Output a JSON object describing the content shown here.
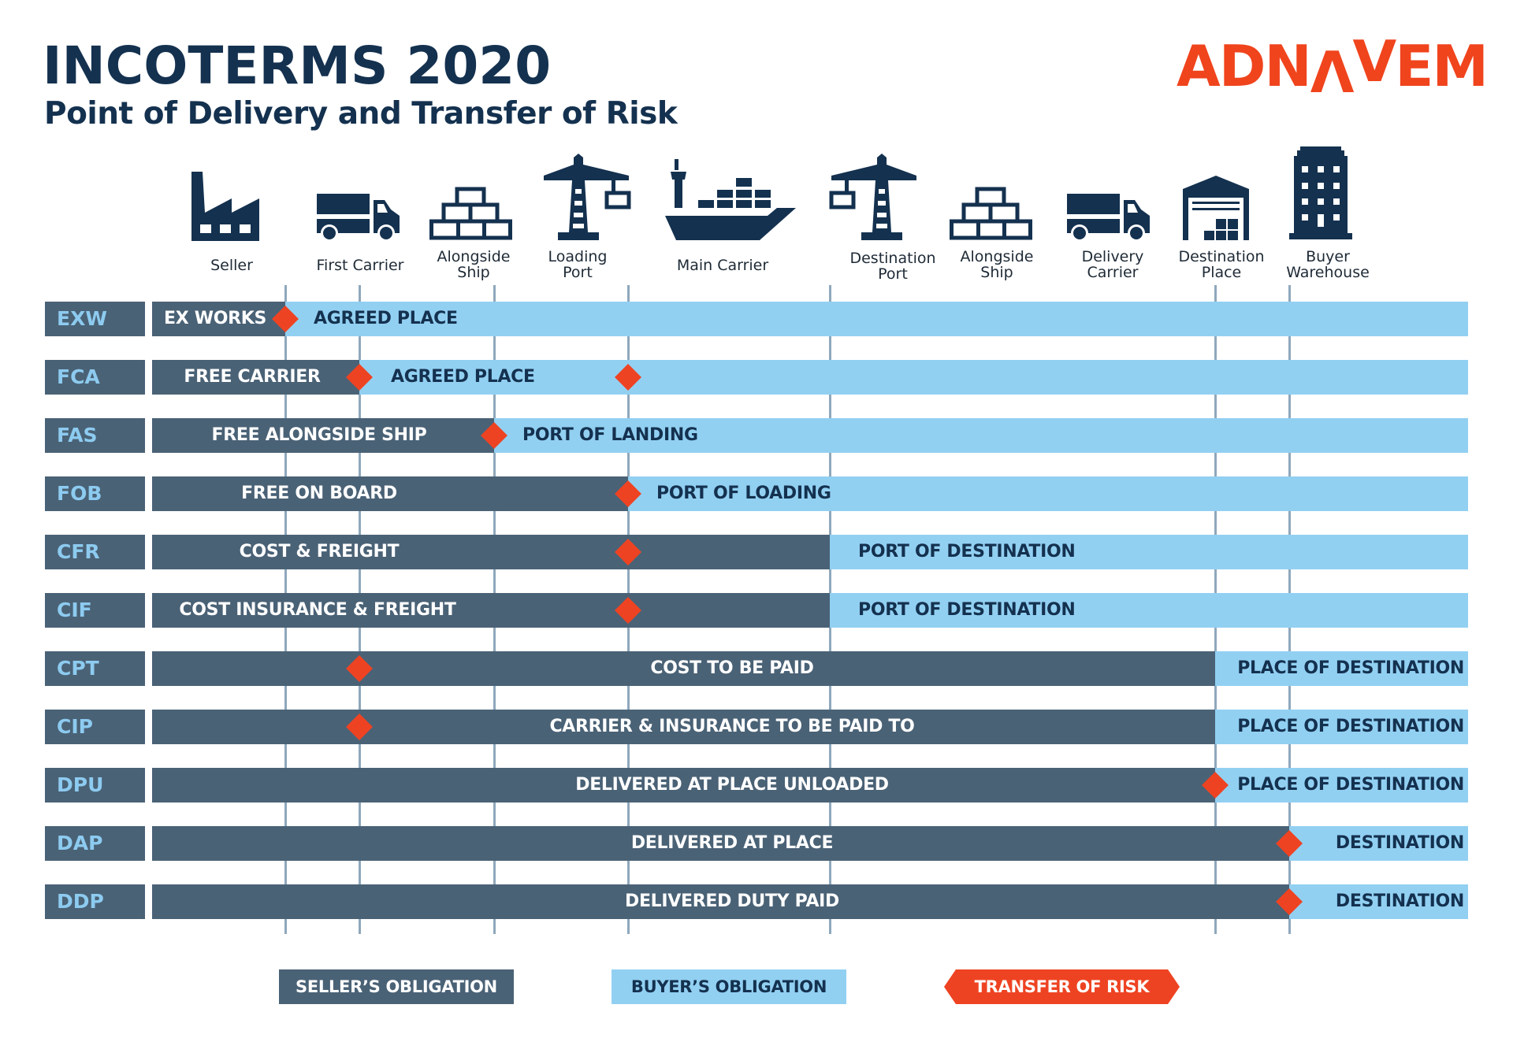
{
  "header": {
    "title": "INCOTERMS 2020",
    "subtitle": "Point of Delivery and Transfer of Risk",
    "logo": {
      "part1": "ADN",
      "lambda": "Λ",
      "vee": "V",
      "part2": "EM",
      "color": "#F0441D"
    }
  },
  "colors": {
    "seller": "#4A6276",
    "buyer": "#92D0F2",
    "risk": "#EE4322",
    "dark_text": "#14314F",
    "code_text": "#8DCBF0",
    "gridline": "#8FA8BC"
  },
  "stages": [
    {
      "key": "seller",
      "label": [
        "Seller"
      ],
      "icon": "factory-icon"
    },
    {
      "key": "first_carrier",
      "label": [
        "First Carrier"
      ],
      "icon": "truck-icon"
    },
    {
      "key": "alongside_ship_origin",
      "label": [
        "Alongside",
        "Ship"
      ],
      "icon": "pallet-stack-icon"
    },
    {
      "key": "loading_port",
      "label": [
        "Loading",
        "Port"
      ],
      "icon": "crane-icon"
    },
    {
      "key": "main_carrier",
      "label": [
        "Main Carrier"
      ],
      "icon": "container-ship-icon"
    },
    {
      "key": "destination_port",
      "label": [
        "Destination",
        "Port"
      ],
      "icon": "crane-icon"
    },
    {
      "key": "alongside_ship_dest",
      "label": [
        "Alongside",
        "Ship"
      ],
      "icon": "pallet-stack-icon"
    },
    {
      "key": "delivery_carrier",
      "label": [
        "Delivery",
        "Carrier"
      ],
      "icon": "truck-icon"
    },
    {
      "key": "destination_place",
      "label": [
        "Destination",
        "Place"
      ],
      "icon": "warehouse-icon"
    },
    {
      "key": "buyer_warehouse",
      "label": [
        "Buyer",
        "Warehouse"
      ],
      "icon": "office-building-icon"
    }
  ],
  "checkpoints": [
    "seller",
    "first_carrier",
    "alongside_ship",
    "loading_port",
    "destination_port",
    "destination_place",
    "buyer_warehouse"
  ],
  "terms": [
    {
      "code": "EXW",
      "seller_text": "EX WORKS",
      "buyer_text": "AGREED PLACE",
      "seller_until": "seller",
      "risk_at": [
        "seller"
      ]
    },
    {
      "code": "FCA",
      "seller_text": "FREE CARRIER",
      "buyer_text": "AGREED PLACE",
      "seller_until": "first_carrier",
      "risk_at": [
        "first_carrier",
        "loading_port"
      ]
    },
    {
      "code": "FAS",
      "seller_text": "FREE ALONGSIDE SHIP",
      "buyer_text": "PORT OF LANDING",
      "seller_until": "alongside_ship",
      "risk_at": [
        "alongside_ship"
      ]
    },
    {
      "code": "FOB",
      "seller_text": "FREE ON BOARD",
      "buyer_text": "PORT OF LOADING",
      "seller_until": "loading_port",
      "risk_at": [
        "loading_port"
      ]
    },
    {
      "code": "CFR",
      "seller_text": "COST & FREIGHT",
      "buyer_text": "PORT OF DESTINATION",
      "seller_until": "destination_port",
      "risk_at": [
        "loading_port"
      ]
    },
    {
      "code": "CIF",
      "seller_text": "COST INSURANCE & FREIGHT",
      "buyer_text": "PORT OF DESTINATION",
      "seller_until": "destination_port",
      "risk_at": [
        "loading_port"
      ]
    },
    {
      "code": "CPT",
      "seller_text": "COST TO BE PAID",
      "buyer_text": "PLACE OF DESTINATION",
      "seller_until": "destination_place",
      "risk_at": [
        "first_carrier"
      ]
    },
    {
      "code": "CIP",
      "seller_text": "CARRIER & INSURANCE TO BE PAID TO",
      "buyer_text": "PLACE OF DESTINATION",
      "seller_until": "destination_place",
      "risk_at": [
        "first_carrier"
      ]
    },
    {
      "code": "DPU",
      "seller_text": "DELIVERED AT PLACE UNLOADED",
      "buyer_text": "PLACE OF DESTINATION",
      "seller_until": "destination_place",
      "risk_at": [
        "destination_place"
      ]
    },
    {
      "code": "DAP",
      "seller_text": "DELIVERED AT PLACE",
      "buyer_text": "DESTINATION",
      "seller_until": "buyer_warehouse",
      "risk_at": [
        "buyer_warehouse"
      ]
    },
    {
      "code": "DDP",
      "seller_text": "DELIVERED DUTY PAID",
      "buyer_text": "DESTINATION",
      "seller_until": "buyer_warehouse",
      "risk_at": [
        "buyer_warehouse"
      ]
    }
  ],
  "legend": {
    "seller": "SELLER’S OBLIGATION",
    "buyer": "BUYER’S OBLIGATION",
    "risk": "TRANSFER OF RISK"
  }
}
